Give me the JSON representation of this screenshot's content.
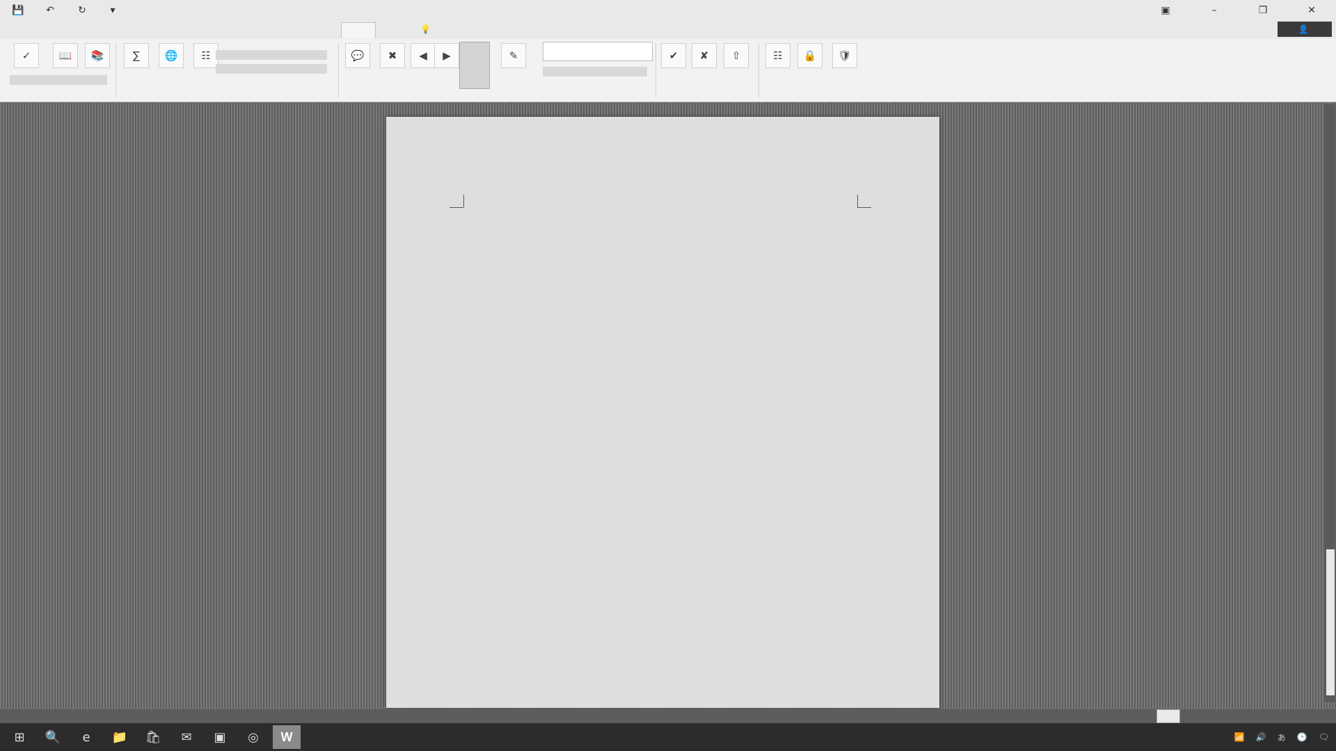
{
  "title": "",
  "quick_access": {
    "save_icon": "save-icon",
    "undo_icon": "undo-icon",
    "redo_icon": "redo-icon",
    "customize_icon": "dropdown-icon"
  },
  "tabs": [
    {
      "label": ""
    },
    {
      "label": ""
    },
    {
      "label": ""
    },
    {
      "label": ""
    },
    {
      "label": ""
    },
    {
      "label": ""
    },
    {
      "label": ""
    },
    {
      "label": ""
    },
    {
      "label": ""
    }
  ],
  "tell_me": "",
  "sign_in": "",
  "share": "",
  "ribbon": {
    "style_box": ""
  },
  "document": {
    "lines": [
      "",
      "",
      "",
      "",
      "",
      "",
      "",
      "",
      "",
      "",
      "",
      "",
      "",
      "",
      "",
      "",
      "",
      "",
      "",
      "",
      "",
      "",
      "",
      ""
    ]
  },
  "statusbar": {
    "page_info": ""
  },
  "taskbar": {
    "word_app": "W"
  },
  "colors": {
    "accent": "#2b579a",
    "page": "#dedede",
    "workspace": "#6a6a6a"
  }
}
